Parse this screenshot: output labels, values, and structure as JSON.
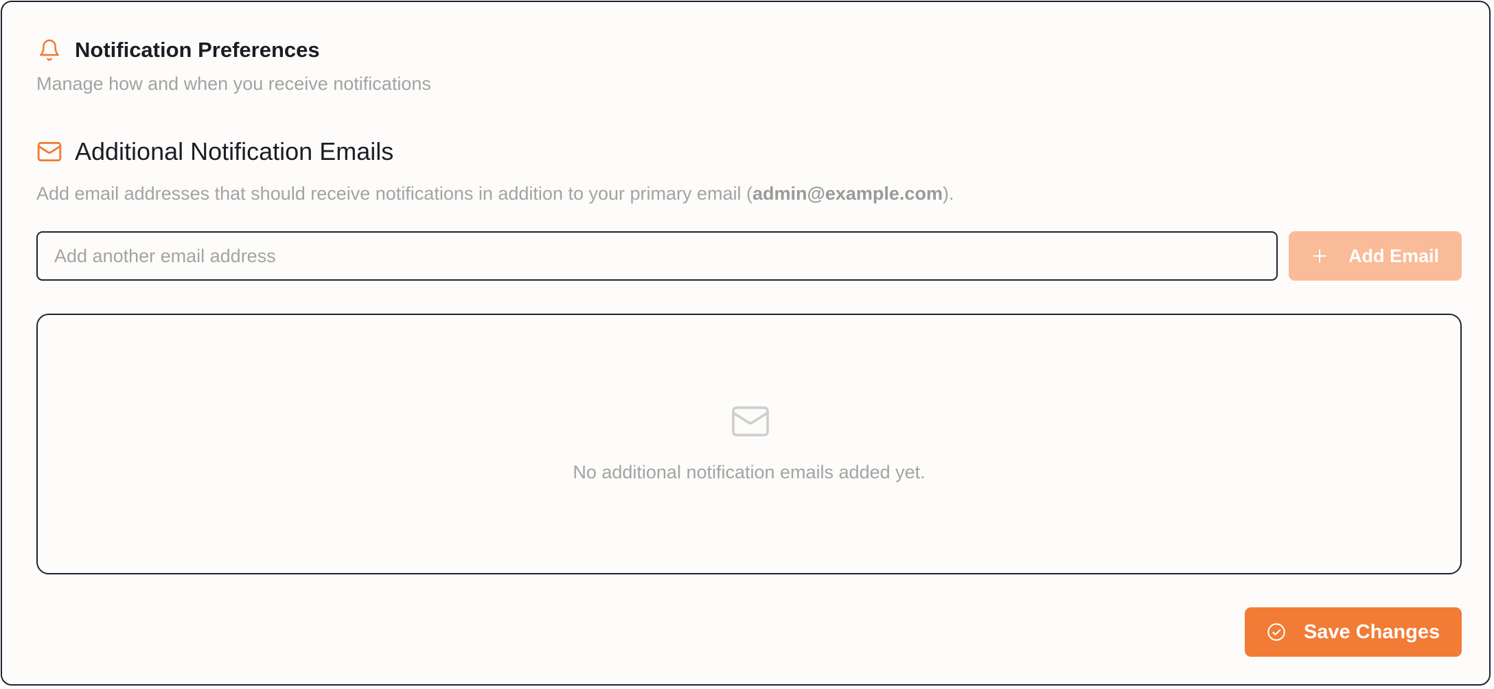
{
  "header": {
    "title": "Notification Preferences",
    "subtitle": "Manage how and when you receive notifications",
    "icon": "bell-icon"
  },
  "section": {
    "title": "Additional Notification Emails",
    "icon": "mail-icon",
    "description_prefix": "Add email addresses that should receive notifications in addition to your primary email (",
    "primary_email": "admin@example.com",
    "description_suffix": ")."
  },
  "email_input": {
    "value": "",
    "placeholder": "Add another email address"
  },
  "add_button": {
    "label": "Add Email",
    "icon": "plus-icon"
  },
  "empty_state": {
    "icon": "mail-icon",
    "message": "No additional notification emails added yet."
  },
  "save_button": {
    "label": "Save Changes",
    "icon": "check-circle-icon"
  },
  "colors": {
    "accent": "#f27b35",
    "accent_disabled": "#f9bb98",
    "muted_text": "#a3a3a3",
    "heading_text": "#1c1c24"
  }
}
